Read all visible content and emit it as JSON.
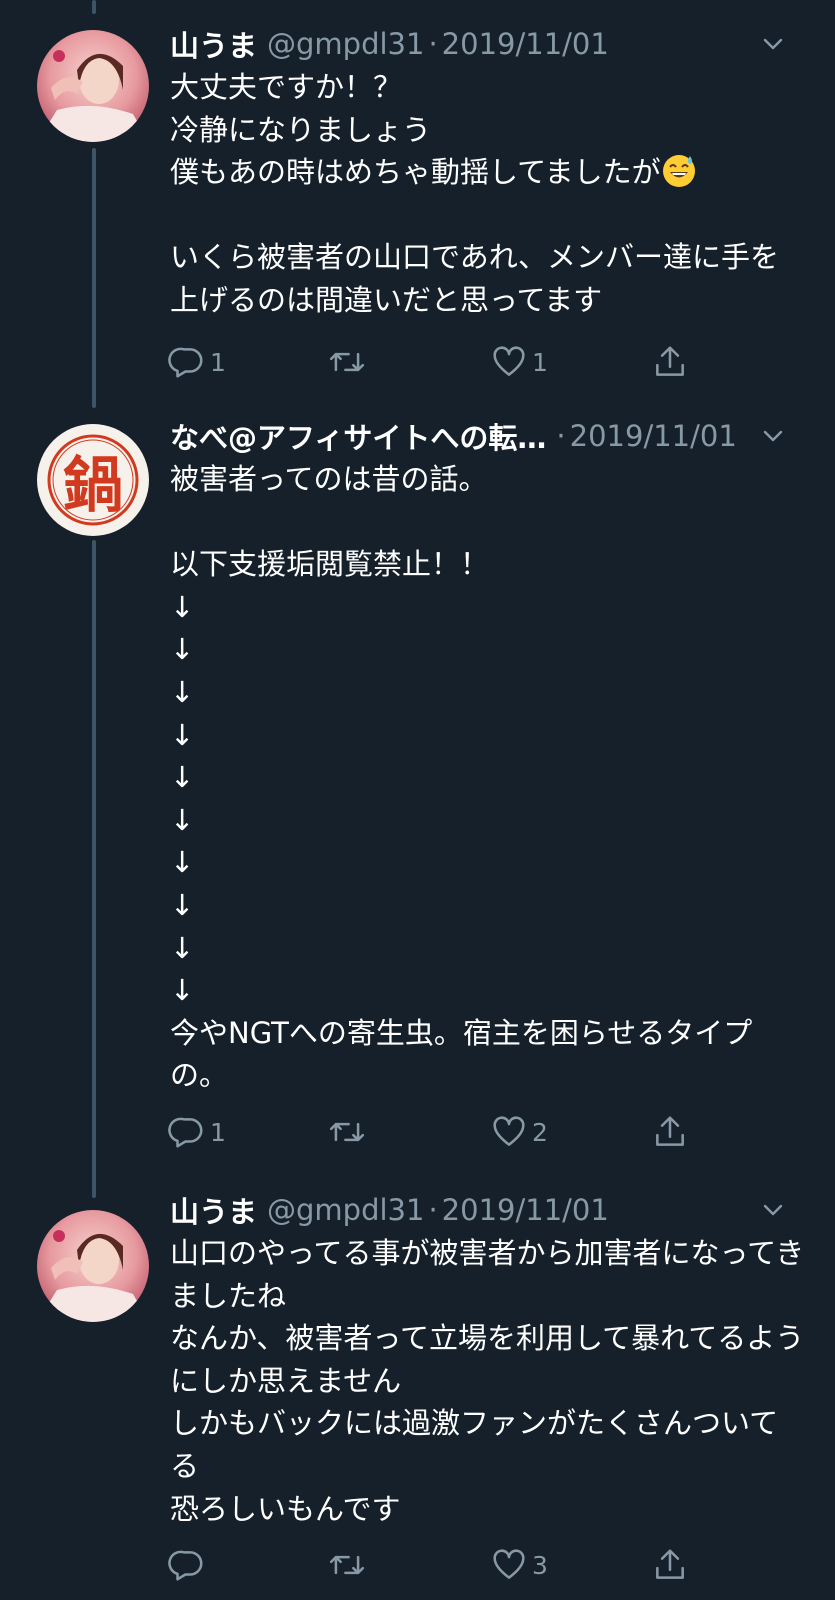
{
  "tweets": [
    {
      "name": "山うま",
      "handle": "@gmpdl31",
      "sep": "·",
      "date": "2019/11/01",
      "text_parts": [
        "大丈夫ですか！？\n冷静になりましょう\n僕もあの時はめちゃ動揺してましたが",
        "\n\nいくら被害者の山口であれ、メンバー達に手を上げるのは間違いだと思ってます"
      ],
      "emoji": "grinning-face-with-sweat",
      "counts": {
        "reply": "1",
        "retweet": "",
        "like": "1"
      }
    },
    {
      "name": "なべ@アフィサイトへの転…",
      "handle": "",
      "sep": "·",
      "date": "2019/11/01",
      "avatar_char": "鍋",
      "text": "被害者ってのは昔の話。\n\n以下支援垢閲覧禁止！！\n↓\n↓\n↓\n↓\n↓\n↓\n↓\n↓\n↓\n↓\n今やNGTへの寄生虫。宿主を困らせるタイプの。",
      "counts": {
        "reply": "1",
        "retweet": "",
        "like": "2"
      }
    },
    {
      "name": "山うま",
      "handle": "@gmpdl31",
      "sep": "·",
      "date": "2019/11/01",
      "text": "山口のやってる事が被害者から加害者になってきましたね\nなんか、被害者って立場を利用して暴れてるようにしか思えません\nしかもバックには過激ファンがたくさんついてる\n恐ろしいもんです",
      "counts": {
        "reply": "",
        "retweet": "",
        "like": "3"
      }
    }
  ],
  "icons": [
    "reply-icon",
    "retweet-icon",
    "like-icon",
    "share-icon",
    "chevron-down-icon"
  ],
  "colors": {
    "background": "#15202b",
    "text": "#ffffff",
    "muted": "#8899a6",
    "thread": "#3d5466",
    "seal_red": "#d13a1e"
  }
}
